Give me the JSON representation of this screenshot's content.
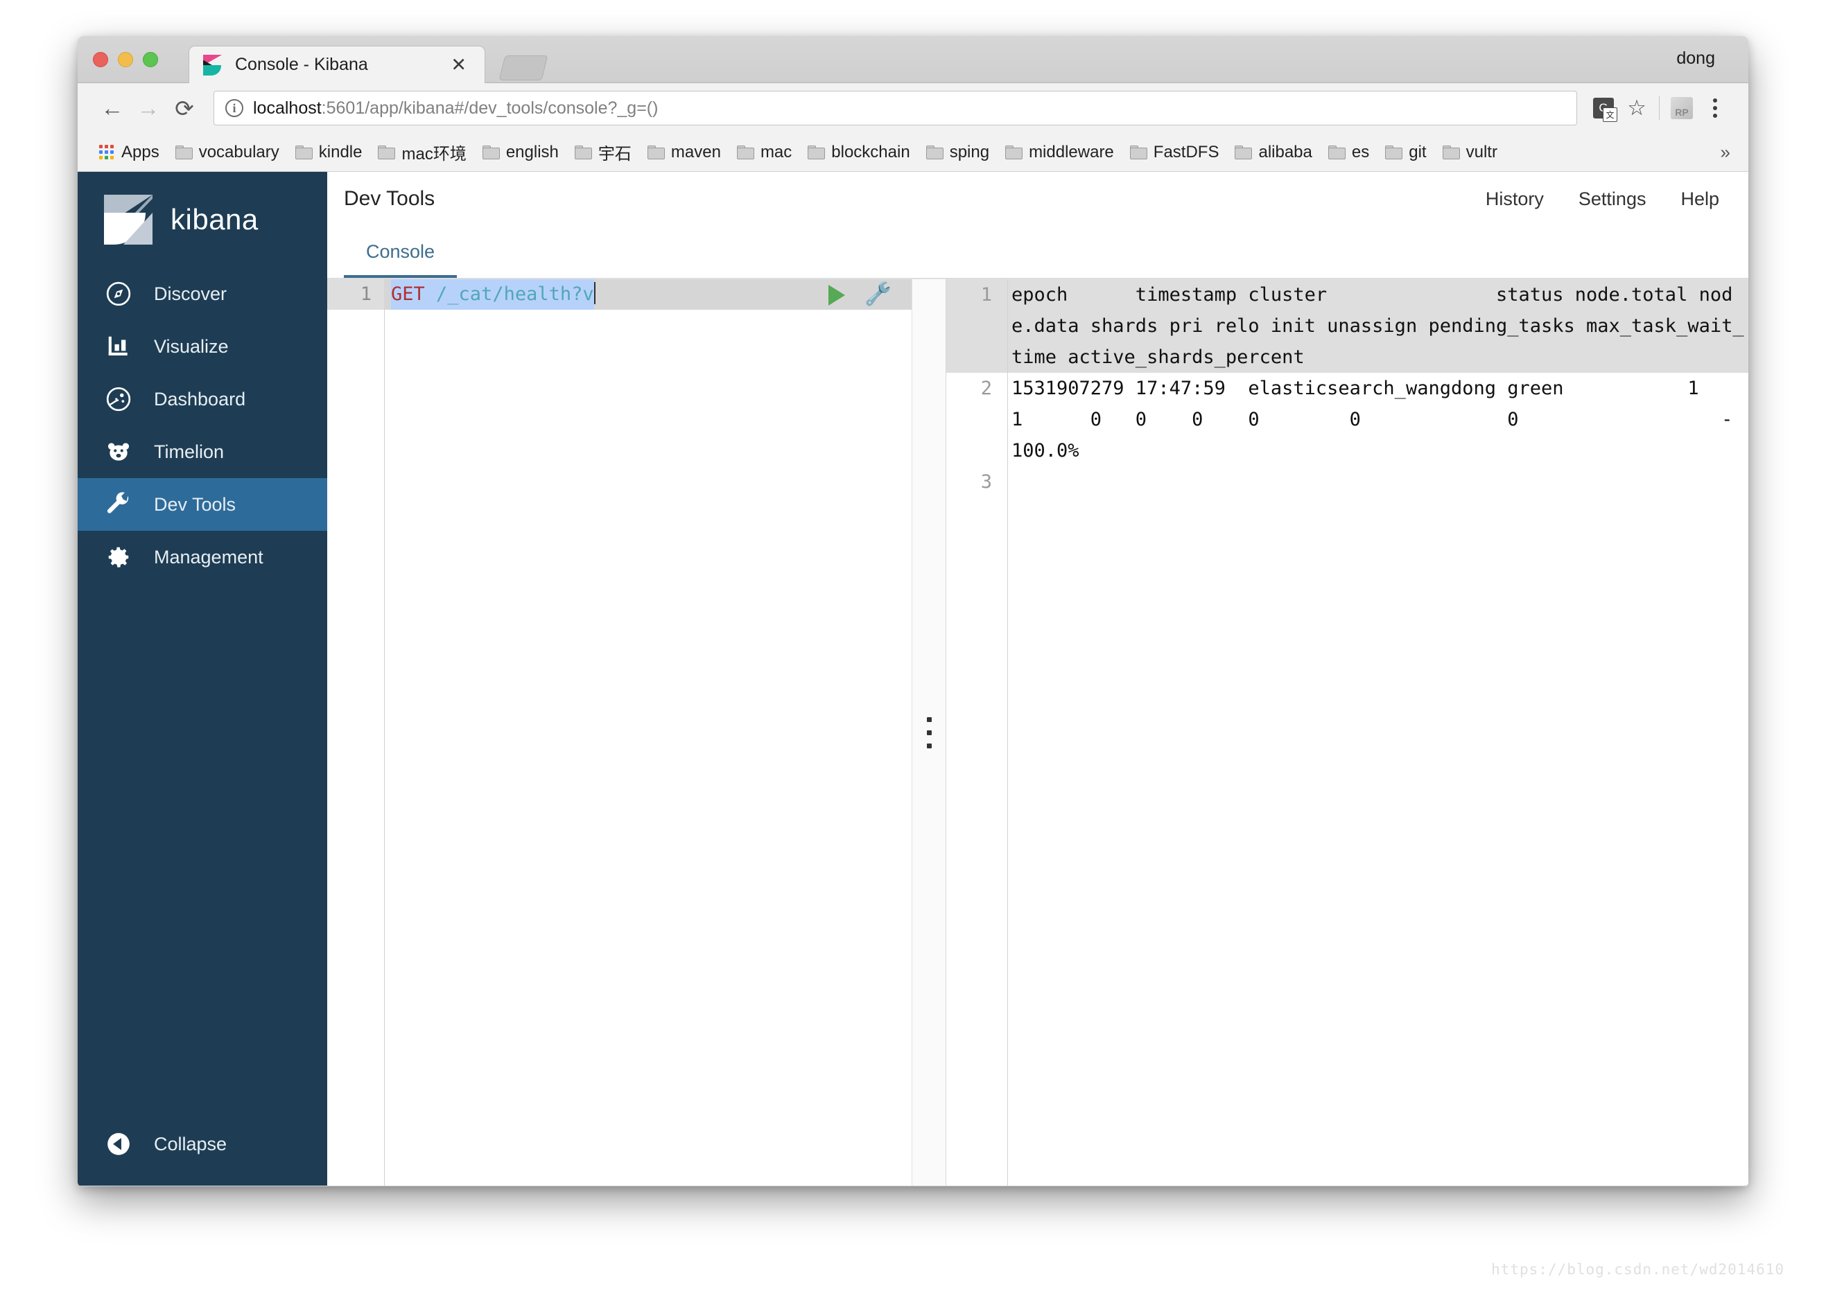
{
  "browser": {
    "tab": {
      "title": "Console - Kibana",
      "close_label": "✕"
    },
    "profile_name": "dong",
    "nav": {
      "back": "←",
      "forward": "→",
      "reload": "⟳"
    },
    "omnibox": {
      "url_host": "localhost",
      "url_rest": ":5601/app/kibana#/dev_tools/console?_g=()",
      "info_glyph": "i"
    },
    "bookmarks": {
      "apps_label": "Apps",
      "overflow_label": "»",
      "items": [
        {
          "label": "vocabulary"
        },
        {
          "label": "kindle"
        },
        {
          "label": "mac环境"
        },
        {
          "label": "english"
        },
        {
          "label": "宇石"
        },
        {
          "label": "maven"
        },
        {
          "label": "mac"
        },
        {
          "label": "blockchain"
        },
        {
          "label": "sping"
        },
        {
          "label": "middleware"
        },
        {
          "label": "FastDFS"
        },
        {
          "label": "alibaba"
        },
        {
          "label": "es"
        },
        {
          "label": "git"
        },
        {
          "label": "vultr"
        }
      ]
    }
  },
  "sidebar": {
    "brand": "kibana",
    "items": [
      {
        "label": "Discover",
        "icon": "compass-icon",
        "active": false
      },
      {
        "label": "Visualize",
        "icon": "bar-chart-icon",
        "active": false
      },
      {
        "label": "Dashboard",
        "icon": "dashboard-icon",
        "active": false
      },
      {
        "label": "Timelion",
        "icon": "bear-icon",
        "active": false
      },
      {
        "label": "Dev Tools",
        "icon": "wrench-icon",
        "active": true
      },
      {
        "label": "Management",
        "icon": "gear-icon",
        "active": false
      }
    ],
    "collapse": {
      "label": "Collapse",
      "icon": "chevron-left-circle-icon"
    }
  },
  "app": {
    "title": "Dev Tools",
    "header_links": [
      {
        "label": "History"
      },
      {
        "label": "Settings"
      },
      {
        "label": "Help"
      }
    ],
    "tabs": [
      {
        "label": "Console",
        "active": true
      }
    ]
  },
  "editor": {
    "line_number": "1",
    "method": "GET",
    "path": " /_cat/health?v",
    "run_button_title": "play-icon",
    "wrench_button_title": "wrench-icon"
  },
  "output": {
    "lines": [
      {
        "number": "1",
        "highlighted": true,
        "text": "epoch      timestamp cluster               status node.total node.data shards pri relo init unassign pending_tasks max_task_wait_time active_shards_percent"
      },
      {
        "number": "2",
        "highlighted": false,
        "text": "1531907279 17:47:59  elasticsearch_wangdong green           1         1      0   0    0    0        0             0                  -                100.0%"
      },
      {
        "number": "3",
        "highlighted": false,
        "text": ""
      }
    ]
  },
  "watermark": "https://blog.csdn.net/wd2014610",
  "colors": {
    "sidebar_bg": "#1e3d54",
    "sidebar_active": "#2d6b9a",
    "tab_accent": "#3d6e8f",
    "method_keyword": "#b03030",
    "path_token": "#52a6b8",
    "selection": "#b6d2fb",
    "run_green": "#56a955"
  }
}
